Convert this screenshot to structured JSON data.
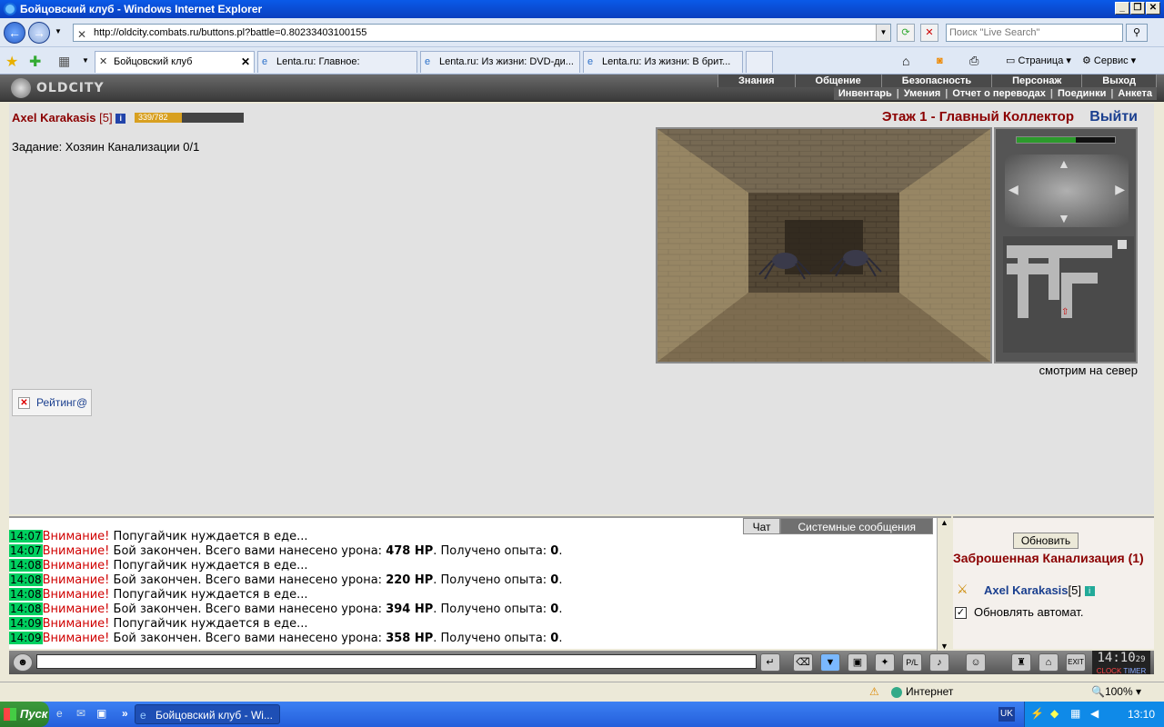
{
  "window": {
    "title": "Бойцовский клуб - Windows Internet Explorer"
  },
  "browser": {
    "url": "http://oldcity.combats.ru/buttons.pl?battle=0.80233403100155",
    "search_placeholder": "Поиск \"Live Search\"",
    "tabs": [
      {
        "label": "Бойцовский клуб",
        "active": true
      },
      {
        "label": "Lenta.ru: Главное:"
      },
      {
        "label": "Lenta.ru: Из жизни: DVD-ди..."
      },
      {
        "label": "Lenta.ru: Из жизни: В брит..."
      }
    ],
    "commands": {
      "page": "Страница",
      "tools": "Сервис"
    }
  },
  "game": {
    "logo": "OLDCITY",
    "menu_top": [
      "Знания",
      "Общение",
      "Безопасность",
      "Персонаж",
      "Выход"
    ],
    "menu_bottom": [
      "Инвентарь",
      "Умения",
      "Отчет о переводах",
      "Поединки",
      "Анкета"
    ],
    "character": {
      "name": "Axel Karakasis",
      "level": "[5]",
      "hp_text": "339/782",
      "hp_fraction": 0.4335
    },
    "quest": "Задание: Хозяин Канализации 0/1",
    "floor": "Этаж 1 - Главный Коллектор",
    "exit": "Выйти",
    "facing": "смотрим на север",
    "rating": "Рейтинг@"
  },
  "chat": {
    "tabs": {
      "chat": "Чат",
      "system": "Системные сообщения"
    },
    "lines": [
      {
        "time": "14:07",
        "warn": "Внимание!",
        "text": " Попугайчик нуждается в еде..."
      },
      {
        "time": "14:07",
        "warn": "Внимание!",
        "text": " Бой закончен. Всего вами нанесено урона: ",
        "bold1": "478 HP",
        "mid": ". Получено опыта: ",
        "bold2": "0",
        "end": "."
      },
      {
        "time": "14:08",
        "warn": "Внимание!",
        "text": " Попугайчик нуждается в еде..."
      },
      {
        "time": "14:08",
        "warn": "Внимание!",
        "text": " Бой закончен. Всего вами нанесено урона: ",
        "bold1": "220 HP",
        "mid": ". Получено опыта: ",
        "bold2": "0",
        "end": "."
      },
      {
        "time": "14:08",
        "warn": "Внимание!",
        "text": " Попугайчик нуждается в еде..."
      },
      {
        "time": "14:08",
        "warn": "Внимание!",
        "text": " Бой закончен. Всего вами нанесено урона: ",
        "bold1": "394 HP",
        "mid": ". Получено опыта: ",
        "bold2": "0",
        "end": "."
      },
      {
        "time": "14:09",
        "warn": "Внимание!",
        "text": " Попугайчик нуждается в еде..."
      },
      {
        "time": "14:09",
        "warn": "Внимание!",
        "text": " Бой закончен. Всего вами нанесено урона: ",
        "bold1": "358 HP",
        "mid": ". Получено опыта: ",
        "bold2": "0",
        "end": "."
      }
    ]
  },
  "side": {
    "refresh": "Обновить",
    "location": "Заброшенная Канализация (1)",
    "player": "Axel Karakasis",
    "player_level": "[5]",
    "auto_refresh": "Обновлять автомат."
  },
  "clock": {
    "time": "14:10",
    "sec": "29",
    "label_clock": "CLOCK",
    "label_timer": "TIMER"
  },
  "statusbar": {
    "zone": "Интернет",
    "zoom": "100%"
  },
  "taskbar": {
    "start": "Пуск",
    "item": "Бойцовский клуб - Wi...",
    "lang": "UK",
    "time": "13:10"
  }
}
